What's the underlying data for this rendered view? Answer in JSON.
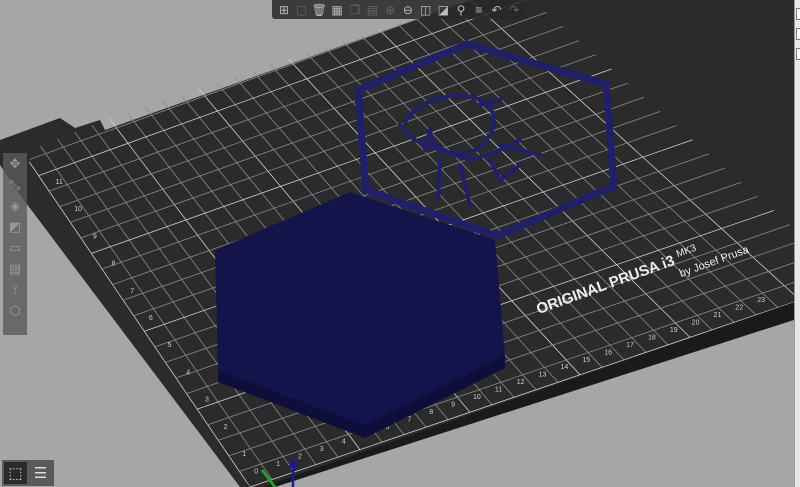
{
  "bed": {
    "logo_main": "ORIGINAL PRUSA i3",
    "logo_model": "MK3",
    "logo_byline": "by Josef Prusa",
    "x_ticks": [
      "0",
      "1",
      "2",
      "3",
      "4",
      "5",
      "6",
      "7",
      "8",
      "9",
      "10",
      "11",
      "12",
      "13",
      "14",
      "15",
      "16",
      "17",
      "18",
      "19",
      "20",
      "21",
      "22",
      "23"
    ],
    "y_ticks": [
      "1",
      "2",
      "3",
      "4",
      "5",
      "6",
      "7",
      "8",
      "9",
      "10",
      "11"
    ],
    "bed_color": "#2b2b2b",
    "grid_color": "#8c8c8c"
  },
  "objects": [
    {
      "name": "hexagon-plate",
      "color": "#1a1a5e"
    },
    {
      "name": "hexagon-outline-portrait",
      "color": "#1e1e66"
    }
  ],
  "toolbar": {
    "buttons": [
      {
        "name": "add",
        "icon": "add-icon"
      },
      {
        "name": "delete",
        "icon": "delete-icon"
      },
      {
        "name": "delete-all",
        "icon": "trash-icon"
      },
      {
        "name": "arrange",
        "icon": "arrange-icon"
      },
      {
        "name": "copy",
        "icon": "copy-icon"
      },
      {
        "name": "paste",
        "icon": "paste-icon"
      },
      {
        "name": "add-instance",
        "icon": "plus-circle-icon"
      },
      {
        "name": "remove-instance",
        "icon": "minus-circle-icon"
      },
      {
        "name": "split-objects",
        "icon": "split-objects-icon"
      },
      {
        "name": "split-parts",
        "icon": "split-parts-icon"
      },
      {
        "name": "search",
        "icon": "search-icon"
      },
      {
        "name": "layers-editing",
        "icon": "layers-icon"
      },
      {
        "name": "undo",
        "icon": "undo-icon"
      },
      {
        "name": "redo",
        "icon": "redo-icon"
      }
    ]
  },
  "gizmos": [
    "move",
    "scale",
    "rotate",
    "place-on-face",
    "cut",
    "supports",
    "seam",
    "sla-support"
  ],
  "view_toggle": [
    "3d-view",
    "preview"
  ]
}
